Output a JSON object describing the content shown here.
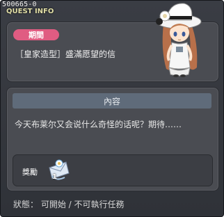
{
  "window": {
    "quest_id": "500665-0",
    "title": "QUEST INFO"
  },
  "period": {
    "badge": "期間",
    "quest_name": "［皇家造型］盛滿愿望的信"
  },
  "content": {
    "heading": "內容",
    "description": "今天布莱尔又会说什么奇怪的话呢？期待……"
  },
  "reward": {
    "label": "獎勵",
    "count": "1",
    "icon": "letter-envelope-icon"
  },
  "status": {
    "text": "狀態： 可開始  / 不可執行任務"
  },
  "colors": {
    "badge": "#e05c82",
    "title": "#e3e0a8",
    "section_head": "#5f6b7a",
    "panel": "#4a4c52"
  }
}
